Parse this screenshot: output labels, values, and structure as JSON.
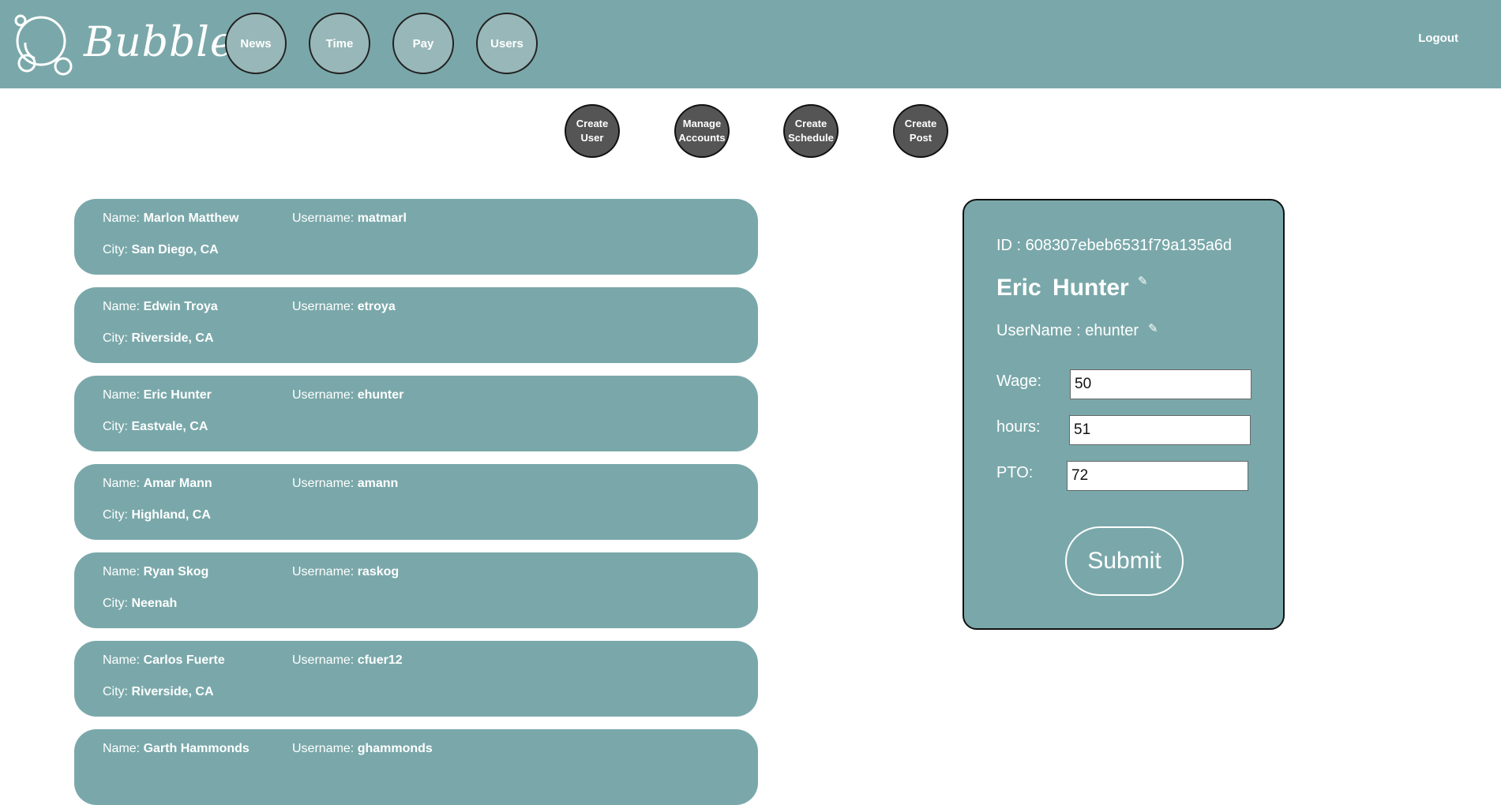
{
  "header": {
    "logo_text": "Bubbles",
    "nav": [
      "News",
      "Time",
      "Pay",
      "Users"
    ],
    "logout": "Logout"
  },
  "actions": [
    {
      "line1": "Create",
      "line2": "User"
    },
    {
      "line1": "Manage",
      "line2": "Accounts"
    },
    {
      "line1": "Create",
      "line2": "Schedule"
    },
    {
      "line1": "Create",
      "line2": "Post"
    }
  ],
  "labels": {
    "name": "Name: ",
    "username": "Username: ",
    "city": "City: "
  },
  "users": [
    {
      "name": "Marlon Matthew",
      "username": "matmarl",
      "city": "San Diego, CA"
    },
    {
      "name": "Edwin Troya",
      "username": "etroya",
      "city": "Riverside, CA"
    },
    {
      "name": "Eric Hunter",
      "username": "ehunter",
      "city": "Eastvale, CA"
    },
    {
      "name": "Amar Mann",
      "username": "amann",
      "city": "Highland, CA"
    },
    {
      "name": "Ryan Skog",
      "username": "raskog",
      "city": "Neenah"
    },
    {
      "name": "Carlos Fuerte",
      "username": "cfuer12",
      "city": "Riverside, CA"
    },
    {
      "name": "Garth Hammonds",
      "username": "ghammonds",
      "city": ""
    }
  ],
  "detail": {
    "id_text": "ID : 608307ebeb6531f79a135a6d",
    "full_name": "Eric Hunter",
    "username_text": "UserName : ehunter",
    "wage_label": "Wage:",
    "wage_value": "50",
    "hours_label": "hours:",
    "hours_value": "51",
    "pto_label": "PTO:",
    "pto_value": "72",
    "submit_label": "Submit"
  },
  "colors": {
    "teal": "#7aa8aa",
    "nav_button": "#98b7b8",
    "action_button": "#555555"
  }
}
